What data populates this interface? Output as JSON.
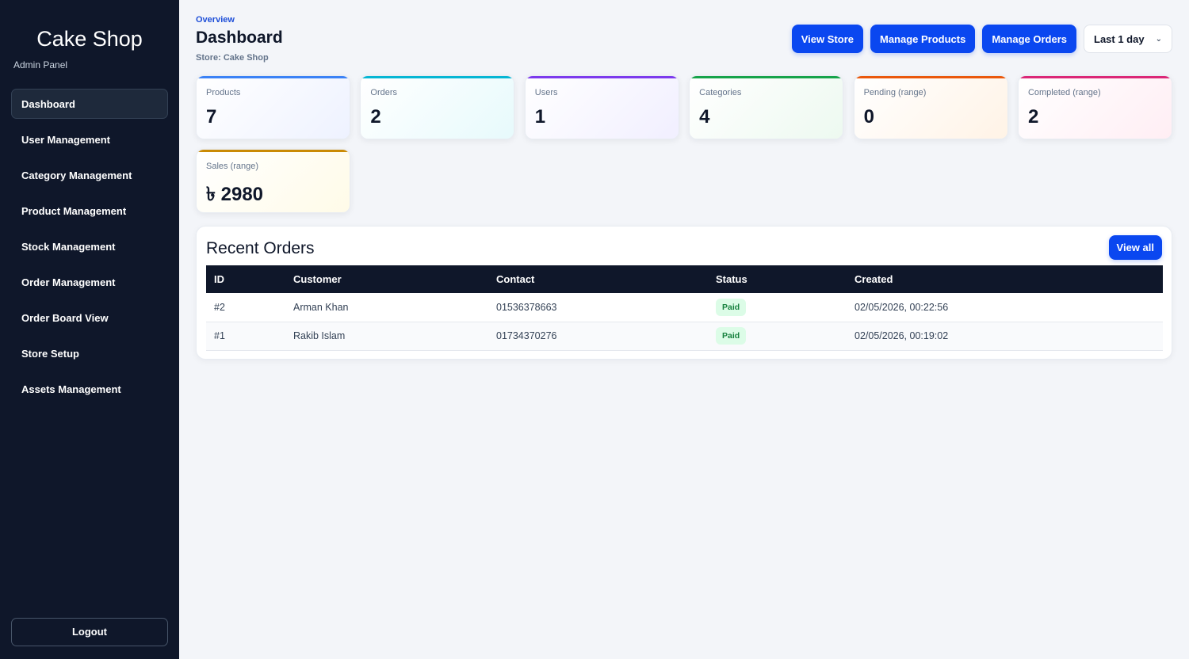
{
  "sidebar": {
    "title": "Cake Shop",
    "subtitle": "Admin Panel",
    "items": [
      {
        "label": "Dashboard"
      },
      {
        "label": "User Management"
      },
      {
        "label": "Category Management"
      },
      {
        "label": "Product Management"
      },
      {
        "label": "Stock Management"
      },
      {
        "label": "Order Management"
      },
      {
        "label": "Order Board View"
      },
      {
        "label": "Store Setup"
      },
      {
        "label": "Assets Management"
      }
    ],
    "logout_label": "Logout"
  },
  "header": {
    "eyebrow": "Overview",
    "title": "Dashboard",
    "store": "Store: Cake Shop",
    "buttons": {
      "view_store": "View Store",
      "manage_products": "Manage Products",
      "manage_orders": "Manage Orders"
    },
    "range_select": "Last 1 day"
  },
  "stats": [
    {
      "label": "Products",
      "value": "7"
    },
    {
      "label": "Orders",
      "value": "2"
    },
    {
      "label": "Users",
      "value": "1"
    },
    {
      "label": "Categories",
      "value": "4"
    },
    {
      "label": "Pending (range)",
      "value": "0"
    },
    {
      "label": "Completed (range)",
      "value": "2"
    },
    {
      "label": "Sales (range)",
      "value": "৳ 2980"
    }
  ],
  "recent_orders": {
    "title": "Recent Orders",
    "view_all_label": "View all",
    "columns": [
      "ID",
      "Customer",
      "Contact",
      "Status",
      "Created"
    ],
    "rows": [
      {
        "id": "#2",
        "customer": "Arman Khan",
        "contact": "01536378663",
        "status": "Paid",
        "created": "02/05/2026, 00:22:56"
      },
      {
        "id": "#1",
        "customer": "Rakib Islam",
        "contact": "01734370276",
        "status": "Paid",
        "created": "02/05/2026, 00:19:02"
      }
    ]
  },
  "colors": {
    "sidebar_bg": "#0f172a",
    "primary_button": "#0a47f0",
    "page_bg": "#f3f5f9",
    "paid_badge_bg": "#dcfce7",
    "paid_badge_text": "#15803d"
  }
}
